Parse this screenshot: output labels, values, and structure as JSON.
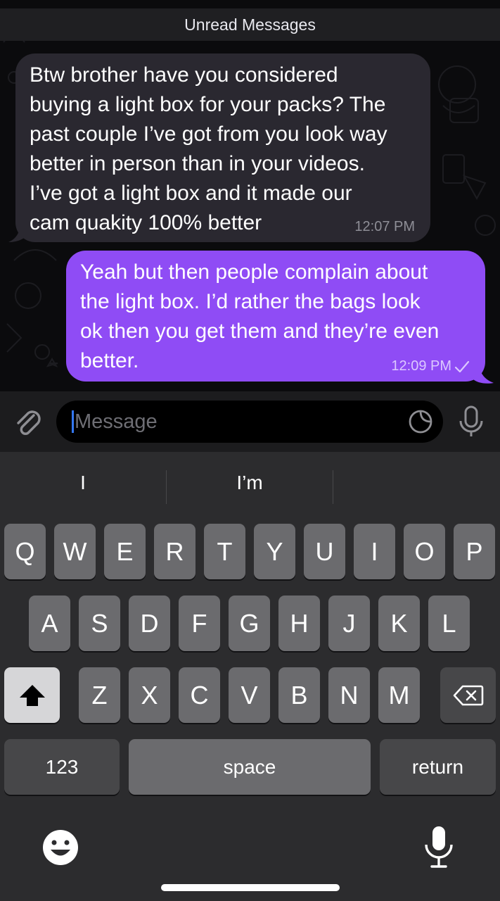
{
  "chat": {
    "unread_label": "Unread Messages",
    "messages": [
      {
        "direction": "incoming",
        "text": "Btw brother have you considered\nbuying a light box for your packs? The\npast couple I’ve got from you look way\nbetter in person than in your videos.\nI’ve got a light box and it made our\ncam quakity 100% better",
        "time": "12:07 PM"
      },
      {
        "direction": "outgoing",
        "text": "Yeah but then people complain about\nthe light box. I’d rather the bags look\nok then you get them and they’re even\nbetter.",
        "time": "12:09 PM",
        "status_icon": "single-check-icon"
      }
    ]
  },
  "composer": {
    "placeholder": "Message",
    "attach_icon": "paperclip-icon",
    "sticker_icon": "sticker-icon",
    "mic_icon": "microphone-icon"
  },
  "keyboard": {
    "suggestions": [
      "I",
      "I’m",
      ""
    ],
    "row1": [
      "Q",
      "W",
      "E",
      "R",
      "T",
      "Y",
      "U",
      "I",
      "O",
      "P"
    ],
    "row2": [
      "A",
      "S",
      "D",
      "F",
      "G",
      "H",
      "J",
      "K",
      "L"
    ],
    "row3": [
      "Z",
      "X",
      "C",
      "V",
      "B",
      "N",
      "M"
    ],
    "shift_icon": "shift-icon",
    "backspace_icon": "backspace-icon",
    "numbers_label": "123",
    "space_label": "space",
    "return_label": "return",
    "emoji_icon": "emoji-icon",
    "dictation_icon": "dictation-microphone-icon"
  },
  "colors": {
    "incoming_bubble": "#2a2830",
    "outgoing_bubble": "#8f4cf5",
    "cursor": "#3478f6"
  }
}
